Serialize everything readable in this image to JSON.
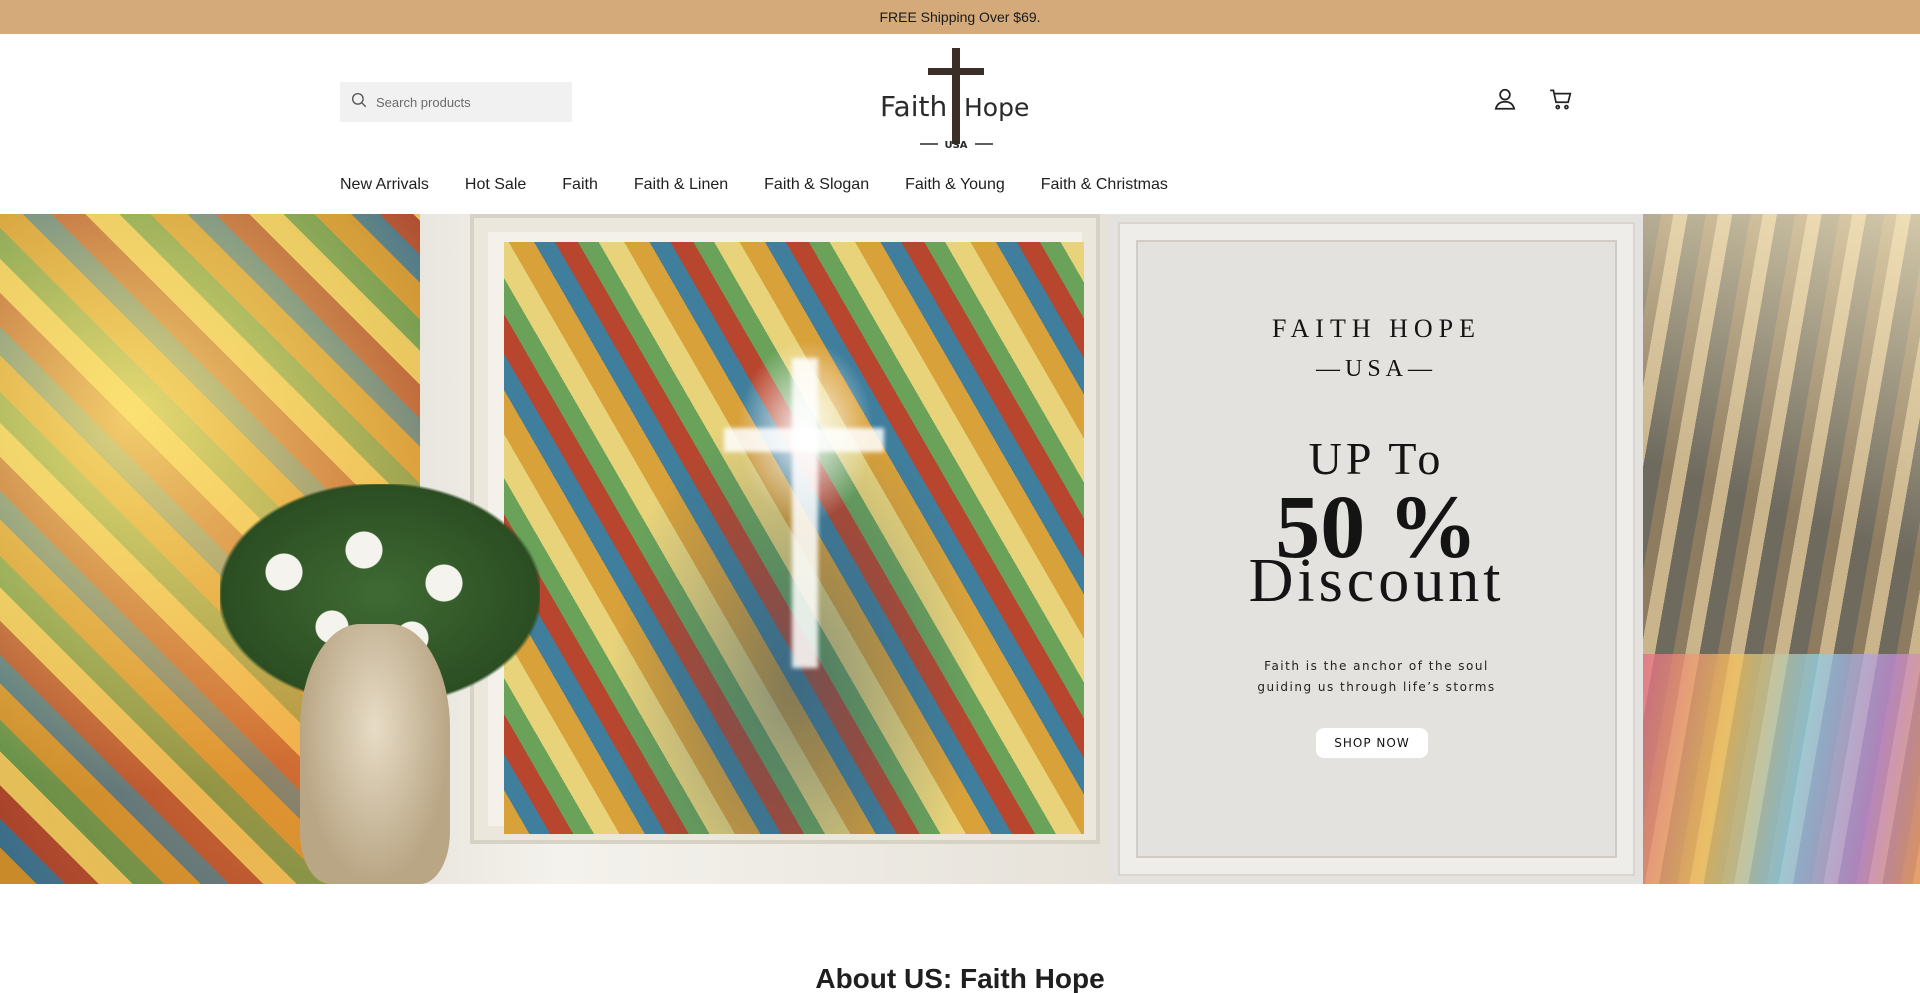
{
  "announcement": {
    "text": "FREE Shipping Over $69."
  },
  "header": {
    "search_placeholder": "Search products",
    "logo": {
      "word1": "Faith",
      "word2": "Hope",
      "tagline": "USA"
    },
    "icons": [
      "account-icon",
      "cart-icon"
    ]
  },
  "nav": {
    "items": [
      {
        "label": "New Arrivals"
      },
      {
        "label": "Hot Sale"
      },
      {
        "label": "Faith"
      },
      {
        "label": "Faith & Linen"
      },
      {
        "label": "Faith & Slogan"
      },
      {
        "label": "Faith & Young"
      },
      {
        "label": "Faith & Christmas"
      }
    ]
  },
  "hero": {
    "brand": "FAITH HOPE",
    "brand_sub": "—USA—",
    "up_to": "UP To",
    "percent": "50 %",
    "discount": "Discount",
    "tagline_line1": "Faith is the anchor of the soul",
    "tagline_line2": "guiding us through life’s storms",
    "cta": "SHOP NOW"
  },
  "about": {
    "title": "About US: Faith Hope"
  },
  "colors": {
    "announcement_bg": "#d4aa7a",
    "search_bg": "#f1f1f1",
    "promo_bg": "#e4e2de"
  }
}
